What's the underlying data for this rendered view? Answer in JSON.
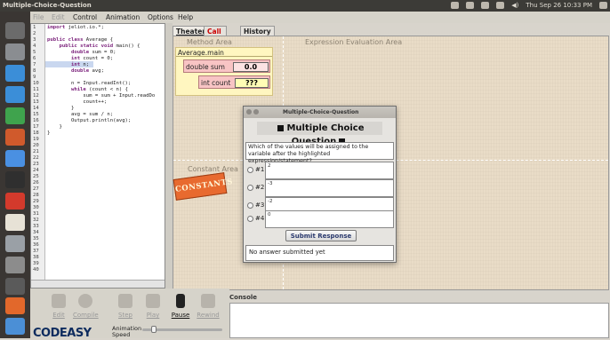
{
  "window": {
    "title": "Multiple-Choice-Question"
  },
  "tray": {
    "datetime": "Thu Sep 26 10:33 PM"
  },
  "menu": [
    "File",
    "Edit",
    "Control",
    "Animation",
    "Options",
    "Help"
  ],
  "code": {
    "line_numbers": [
      "1",
      "2",
      "3",
      "4",
      "5",
      "6",
      "7",
      "8",
      "9",
      "10",
      "11",
      "12",
      "13",
      "14",
      "15",
      "16",
      "17",
      "18",
      "19",
      "20",
      "21",
      "22",
      "23",
      "24",
      "25",
      "26",
      "27",
      "28",
      "29",
      "30",
      "31",
      "32",
      "33",
      "34",
      "35",
      "36",
      "37",
      "38",
      "39",
      "40"
    ],
    "lines": [
      "import jeliot.io.*;",
      "",
      "public class Average {",
      "    public static void main() {",
      "        double sum = 0;",
      "        int count = 0;",
      "        int n;",
      "        double avg;",
      "",
      "        n = Input.readInt();",
      "        while (count < n) {",
      "            sum = sum + Input.readDo",
      "            count++;",
      "        }",
      "        avg = sum / n;",
      "        Output.println(avg);",
      "    }",
      "}"
    ]
  },
  "tabs": [
    "Theater",
    "Call Tree",
    "History"
  ],
  "theater": {
    "method_area": "Method Area",
    "expression_area": "Expression Evaluation Area",
    "constant_area": "Constant Area",
    "constants": "CONSTANTS",
    "frame": {
      "name": "Average.main",
      "vars": [
        {
          "label": "double sum",
          "value": "0.0"
        },
        {
          "label": "int count",
          "value": "???"
        }
      ]
    }
  },
  "dialog": {
    "title": "Multiple-Choice-Question",
    "heading": "Multiple Choice Question",
    "question": "Which of the values will be assigned to the variable after the highlighted expression/statement?",
    "options": [
      {
        "num": "#1",
        "value": "2"
      },
      {
        "num": "#2",
        "value": "-3"
      },
      {
        "num": "#3",
        "value": "-2"
      },
      {
        "num": "#4",
        "value": "0"
      }
    ],
    "submit": "Submit Response",
    "answer_status": "No answer submitted yet"
  },
  "console": {
    "label": "Console"
  },
  "controls": {
    "edit": "Edit",
    "compile": "Compile",
    "step": "Step",
    "play": "Play",
    "pause": "Pause",
    "rewind": "Rewind",
    "animation": "Animation",
    "speed": "Speed",
    "logo": "CODEASY"
  },
  "colors": {
    "accent": "#e86a2f",
    "var_bg": "#f8c4c4",
    "frame_bg": "#fff6c0",
    "theater_bg": "#e9dcc7"
  }
}
